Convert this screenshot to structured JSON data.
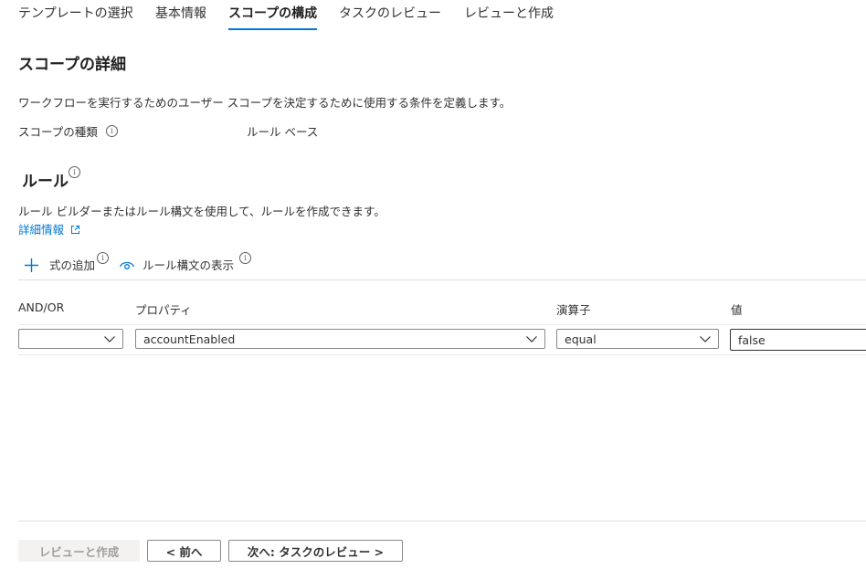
{
  "tabs": [
    {
      "label": "テンプレートの選択"
    },
    {
      "label": "基本情報"
    },
    {
      "label": "スコープの構成"
    },
    {
      "label": "タスクのレビュー"
    },
    {
      "label": "レビューと作成"
    }
  ],
  "active_tab": "スコープの構成",
  "scope_details": {
    "title": "スコープの詳細",
    "description": "ワークフローを実行するためのユーザー スコープを決定するために使用する条件を定義します。",
    "scope_type_label": "スコープの種類",
    "scope_type_value": "ルール ベース"
  },
  "rules": {
    "title": "ルール",
    "description": "ルール ビルダーまたはルール構文を使用して、ルールを作成できます。",
    "learn_more": "詳細情報",
    "add_expression": "式の追加",
    "show_syntax": "ルール構文の表示"
  },
  "table": {
    "headers": {
      "andor": "AND/OR",
      "property": "プロパティ",
      "operator": "演算子",
      "value": "値"
    },
    "row": {
      "andor": "",
      "property": "accountEnabled",
      "operator": "equal",
      "value": "false"
    }
  },
  "footer": {
    "review_create": "レビューと作成",
    "previous": "< 前へ",
    "next": "次へ: タスクのレビュー >"
  },
  "colors": {
    "accent": "#0078d4",
    "text": "#323130",
    "border": "#8a8886"
  },
  "icons": [
    "info-icon",
    "external-link-icon",
    "plus-icon",
    "eye-icon",
    "chevron-down-icon"
  ]
}
